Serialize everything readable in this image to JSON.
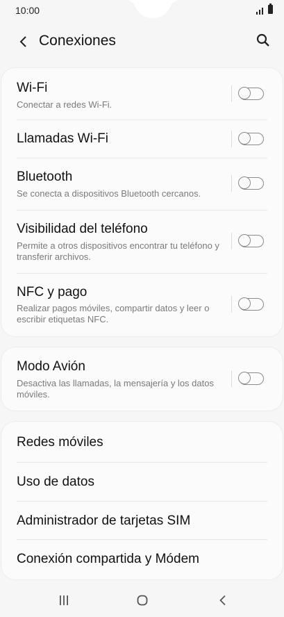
{
  "status": {
    "time": "10:00"
  },
  "header": {
    "title": "Conexiones"
  },
  "connections": [
    {
      "title": "Wi-Fi",
      "subtitle": "Conectar a redes Wi-Fi."
    },
    {
      "title": "Llamadas Wi-Fi",
      "subtitle": ""
    },
    {
      "title": "Bluetooth",
      "subtitle": "Se conecta a dispositivos Bluetooth cercanos."
    },
    {
      "title": "Visibilidad del teléfono",
      "subtitle": "Permite a otros dispositivos encontrar tu teléfono y transferir archivos."
    },
    {
      "title": "NFC y pago",
      "subtitle": "Realizar pagos móviles, compartir datos y leer o escribir etiquetas NFC."
    }
  ],
  "airplane": {
    "title": "Modo Avión",
    "subtitle": "Desactiva las llamadas, la mensajería y los datos móviles."
  },
  "more": [
    {
      "title": "Redes móviles"
    },
    {
      "title": "Uso de datos"
    },
    {
      "title": "Administrador de tarjetas SIM"
    },
    {
      "title": "Conexión compartida y Módem"
    }
  ],
  "toggles": {
    "wifi": false,
    "wifi_calling": false,
    "bluetooth": false,
    "visibility": false,
    "nfc": false,
    "airplane": false
  },
  "icons": [
    "back-icon",
    "search-icon",
    "signal-icon",
    "battery-icon",
    "recents-icon",
    "home-icon",
    "nav-back-icon"
  ]
}
